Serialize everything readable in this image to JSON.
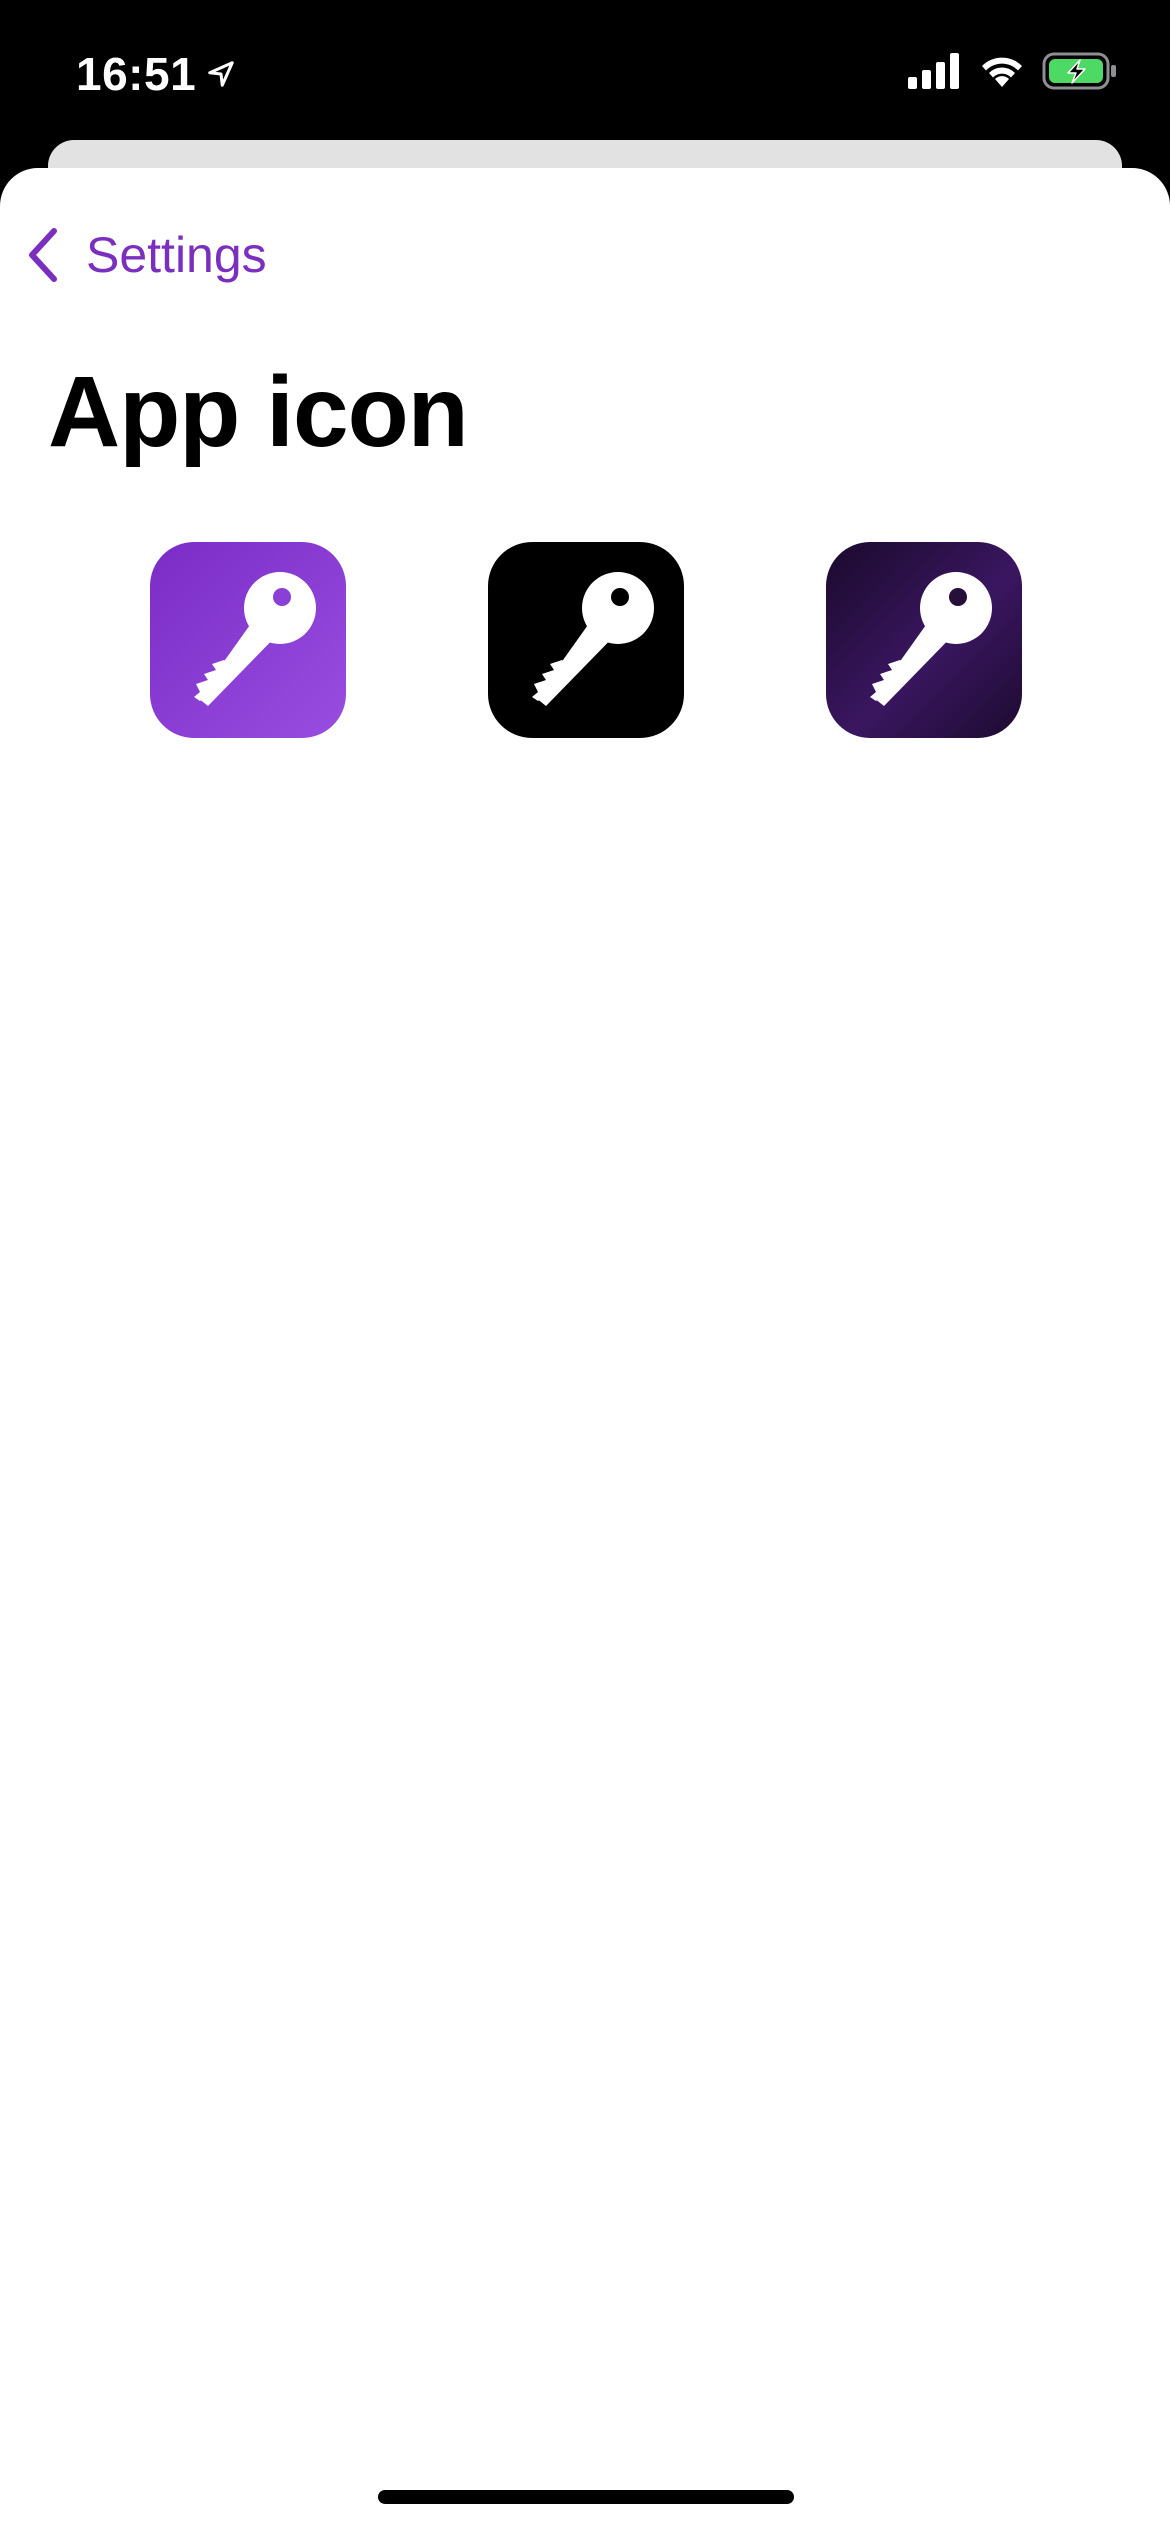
{
  "status_bar": {
    "time": "16:51",
    "location_icon": "location-arrow-icon",
    "signal_icon": "cellular-signal-icon",
    "wifi_icon": "wifi-icon",
    "battery_icon": "battery-charging-icon",
    "battery_color": "#4cd964"
  },
  "nav": {
    "back_label": "Settings",
    "back_icon": "chevron-left-icon"
  },
  "page": {
    "title": "App icon"
  },
  "app_icons": [
    {
      "name": "purple",
      "icon": "key-icon",
      "color": "#8a3fd6"
    },
    {
      "name": "black",
      "icon": "key-icon",
      "color": "#000000"
    },
    {
      "name": "dark-purple",
      "icon": "key-icon",
      "color": "#24103a"
    }
  ],
  "colors": {
    "accent": "#7b2fbe",
    "background": "#ffffff"
  }
}
